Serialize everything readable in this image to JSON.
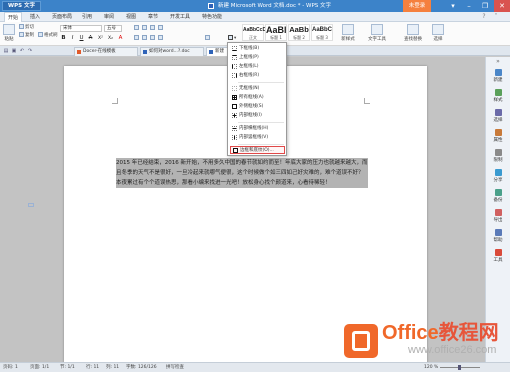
{
  "titlebar": {
    "app_button": "WPS 文字",
    "title": "新建 Microsoft Word 文档.doc * - WPS 文字",
    "login": "未登录",
    "controls": [
      "▾",
      "–",
      "❐",
      "✕"
    ]
  },
  "menubar": {
    "items": [
      "开始",
      "插入",
      "页面布局",
      "引用",
      "审阅",
      "视图",
      "章节",
      "开发工具",
      "特色功能"
    ]
  },
  "ribbon": {
    "paste": "粘贴",
    "cut": "剪切",
    "copy": "复制",
    "format_painter": "格式刷",
    "font_name": "宋体",
    "font_size": "五号",
    "format_buttons": [
      "B",
      "I",
      "U",
      "A",
      "X²",
      "X₂",
      "A"
    ],
    "styles": [
      {
        "preview": "AaBbCcDd",
        "label": "正文"
      },
      {
        "preview": "AaBl",
        "label": "标题 1"
      },
      {
        "preview": "AaBb",
        "label": "标题 2"
      },
      {
        "preview": "AaBbC",
        "label": "标题 3"
      }
    ],
    "new_style": "新样式",
    "text_tools": "文字工具",
    "find_replace": "查找替换",
    "select": "选择"
  },
  "tabbar": {
    "tabs": [
      {
        "label": "Docer-在线模板",
        "active": false
      },
      {
        "label": "如何对word...?.doc",
        "active": false
      },
      {
        "label": "新建",
        "active": true
      }
    ]
  },
  "borders_menu": {
    "items": [
      "下框线(B)",
      "上框线(P)",
      "左框线(L)",
      "右框线(R)",
      "无框线(N)",
      "所有框线(A)",
      "外侧框线(S)",
      "内部框线(I)",
      "内部横框线(H)",
      "内部竖框线(V)",
      "边框和底纹(O)..."
    ],
    "highlighted_index": 10
  },
  "document": {
    "text": "2015 年已经结束，2016 新开始，不用多久中国的春节就如约而至！年底大家的压力也就越来越大，而且冬季的天气不是很好，一旦冷起来就哪气便很，这个时候做个如三四如己好灾难的，难个道误不好？本夜累过有个个道误热思，那看小编来找进一光吧！放松身心找个颜道来，心看待稀轻！"
  },
  "sidebar": {
    "items": [
      "新建",
      "样式",
      "选择",
      "属性",
      "限制",
      "分享",
      "备份",
      "导出",
      "帮助",
      "工具"
    ]
  },
  "statusbar": {
    "page": "页码: 1",
    "pages": "页面: 1/1",
    "section": "节: 1/1",
    "row": "行: 11",
    "col": "列: 11",
    "words": "字数: 126/126",
    "spell": "拼写检查",
    "zoom": "120 %"
  },
  "watermark": {
    "title_part1": "Office",
    "title_part2": "教程网",
    "url": "www.office26.com"
  },
  "colors": {
    "titlebar": "#3c83c9",
    "login": "#f5803e",
    "brand_orange": "#f0682a",
    "highlight_border": "#e04848"
  }
}
